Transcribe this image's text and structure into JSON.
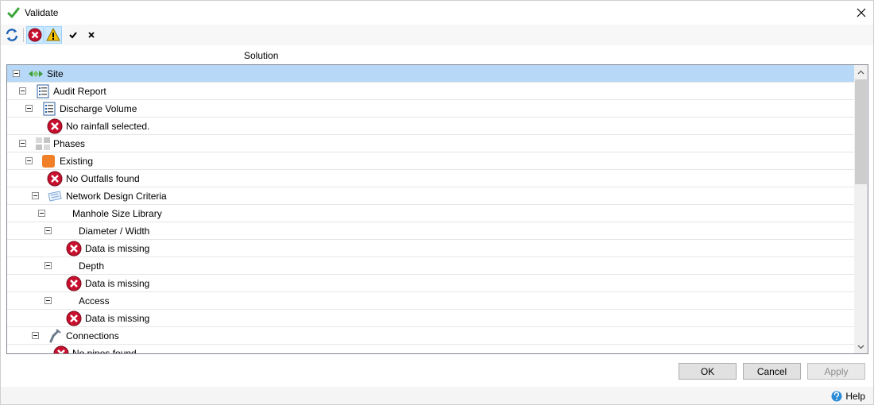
{
  "window": {
    "title": "Validate"
  },
  "toolbar": {
    "buttons": [
      {
        "icon": "refresh-icon"
      },
      {
        "icon": "error-filter-icon"
      },
      {
        "icon": "warning-filter-icon"
      },
      {
        "icon": "check-icon"
      },
      {
        "icon": "x-icon"
      }
    ]
  },
  "column_header": "Solution",
  "tree": {
    "rows": [
      {
        "label": "Site",
        "type": "node",
        "icon": "site-icon"
      },
      {
        "label": "Audit Report",
        "type": "node",
        "icon": "report-icon"
      },
      {
        "label": "Discharge Volume",
        "type": "node",
        "icon": "report-icon"
      },
      {
        "label": "No rainfall selected.",
        "type": "error",
        "icon": "error-icon"
      },
      {
        "label": "Phases",
        "type": "node",
        "icon": "phases-icon"
      },
      {
        "label": "Existing",
        "type": "node",
        "icon": "phase-existing-icon"
      },
      {
        "label": "No Outfalls found",
        "type": "error",
        "icon": "error-icon"
      },
      {
        "label": "Network Design Criteria",
        "type": "node",
        "icon": "design-criteria-icon"
      },
      {
        "label": "Manhole Size Library",
        "type": "node"
      },
      {
        "label": "Diameter / Width",
        "type": "node"
      },
      {
        "label": "Data is missing",
        "type": "error",
        "icon": "error-icon"
      },
      {
        "label": "Depth",
        "type": "node"
      },
      {
        "label": "Data is missing",
        "type": "error",
        "icon": "error-icon"
      },
      {
        "label": "Access",
        "type": "node"
      },
      {
        "label": "Data is missing",
        "type": "error",
        "icon": "error-icon"
      },
      {
        "label": "Connections",
        "type": "node",
        "icon": "pipe-icon"
      },
      {
        "label": "No pipes found",
        "type": "error",
        "icon": "error-icon"
      }
    ]
  },
  "buttons": {
    "ok": "OK",
    "cancel": "Cancel",
    "apply": "Apply"
  },
  "help": {
    "label": "Help"
  },
  "colors": {
    "selection": "#b7d8f7",
    "error": "#c8102e",
    "warning": "#f5c400"
  }
}
